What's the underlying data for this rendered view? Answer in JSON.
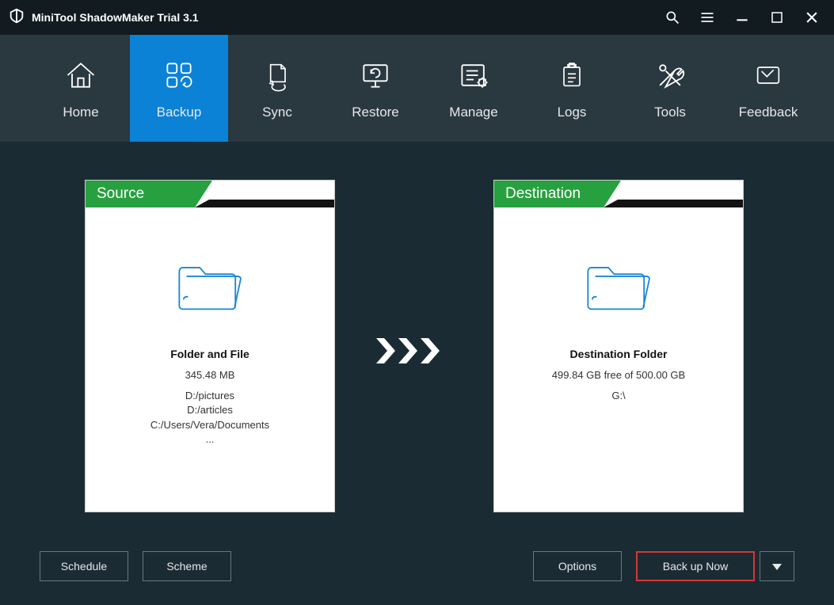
{
  "app": {
    "title": "MiniTool ShadowMaker Trial 3.1"
  },
  "nav": {
    "items": [
      {
        "label": "Home"
      },
      {
        "label": "Backup"
      },
      {
        "label": "Sync"
      },
      {
        "label": "Restore"
      },
      {
        "label": "Manage"
      },
      {
        "label": "Logs"
      },
      {
        "label": "Tools"
      },
      {
        "label": "Feedback"
      }
    ]
  },
  "source": {
    "banner": "Source",
    "title": "Folder and File",
    "size": "345.48 MB",
    "paths": [
      "D:/pictures",
      "D:/articles",
      "C:/Users/Vera/Documents"
    ],
    "more": "..."
  },
  "destination": {
    "banner": "Destination",
    "title": "Destination Folder",
    "free": "499.84 GB free of 500.00 GB",
    "drive": "G:\\"
  },
  "buttons": {
    "schedule": "Schedule",
    "scheme": "Scheme",
    "options": "Options",
    "backup_now": "Back up Now"
  }
}
